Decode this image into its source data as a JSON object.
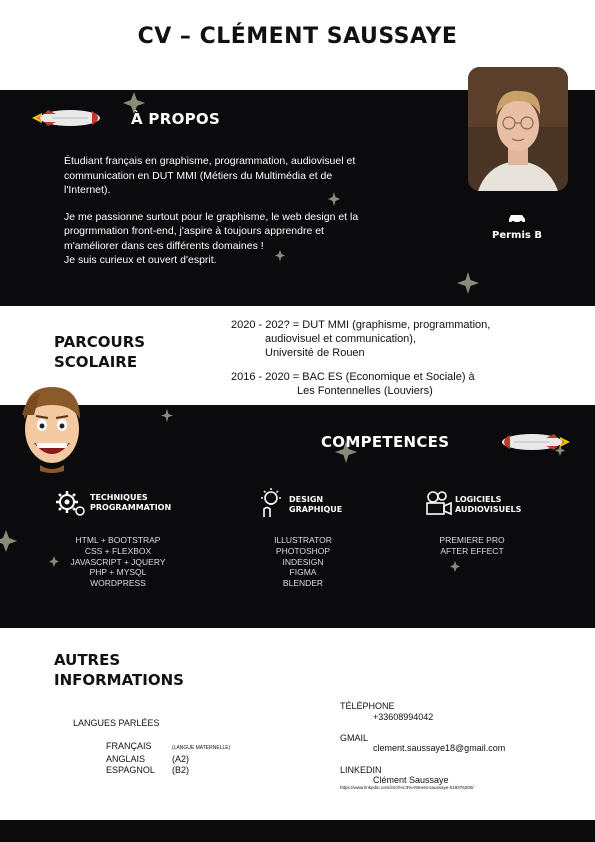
{
  "title": "CV  –  CLÉMENT SAUSSAYE",
  "about": {
    "heading": "À PROPOS",
    "line1": "Étudiant français en graphisme, programmation, audiovisuel et",
    "line2": "communication en DUT MMI (Métiers du Multimédia et de",
    "line3": "l'Internet).",
    "line4": "Je me passionne surtout pour le graphisme, le web design et la",
    "line5": "progrmmation front-end, j'aspire à toujours apprendre et",
    "line6": "m'améliorer dans ces différents domaines !",
    "line7": "Je suis curieux et ouvert d'esprit.",
    "permis": "Permis B",
    "car_icon": "car-icon"
  },
  "parcours": {
    "heading_line1": "PARCOURS",
    "heading_line2": "SCOLAIRE",
    "entry1_line1": "2020 - 202? = DUT MMI (graphisme, programmation,",
    "entry1_line2": "audiovisuel et communication),",
    "entry1_line3": "Université de Rouen",
    "entry2_line1": "2016 - 2020 = BAC ES (Economique et Sociale) à",
    "entry2_line2": "Les Fontennelles (Louviers)"
  },
  "competences": {
    "heading": "COMPETENCES",
    "groups": [
      {
        "icon": "gears-icon",
        "head1": "TECHNIQUES",
        "head2": "PROGRAMMATION",
        "items": [
          "HTML + BOOTSTRAP",
          "CSS + FLEXBOX",
          "JAVASCRIPT + JQUERY",
          "PHP + MYSQL",
          "WORDPRESS"
        ]
      },
      {
        "icon": "lightbulb-hand-icon",
        "head1": "DESIGN",
        "head2": "GRAPHIQUE",
        "items": [
          "ILLUSTRATOR",
          "PHOTOSHOP",
          "INDESIGN",
          "FIGMA",
          "BLENDER"
        ]
      },
      {
        "icon": "video-camera-icon",
        "head1": "LOGICIELS",
        "head2": "AUDIOVISUELS",
        "items": [
          "PREMIERE PRO",
          "AFTER EFFECT"
        ]
      }
    ]
  },
  "autres": {
    "heading_line1": "AUTRES",
    "heading_line2": "INFORMATIONS",
    "langues_label": "LANGUES PARLÉES",
    "lang1": "FRANÇAIS",
    "lang1_level": "(LANGUE MATERNELLE)",
    "lang2": "ANGLAIS",
    "lang2_level": "(A2)",
    "lang3": "ESPAGNOL",
    "lang3_level": "(B2)",
    "tel_label": "TÉLÉPHONE",
    "tel_value": "+33608994042",
    "mail_label": "GMAIL",
    "mail_value": "clement.saussaye18@gmail.com",
    "linkedin_label": "LINKEDIN",
    "linkedin_name": "Clément Saussaye",
    "linkedin_url": "https://www.linkedin.com/in/cl%C3%A9ment-saussaye-519376200/"
  },
  "colors": {
    "dark_band": "#0b0b0d",
    "star": "#8a8a78",
    "rocket_body": "#e9e9e9",
    "rocket_nose": "#c0392b",
    "flame": "#f1c40f"
  }
}
